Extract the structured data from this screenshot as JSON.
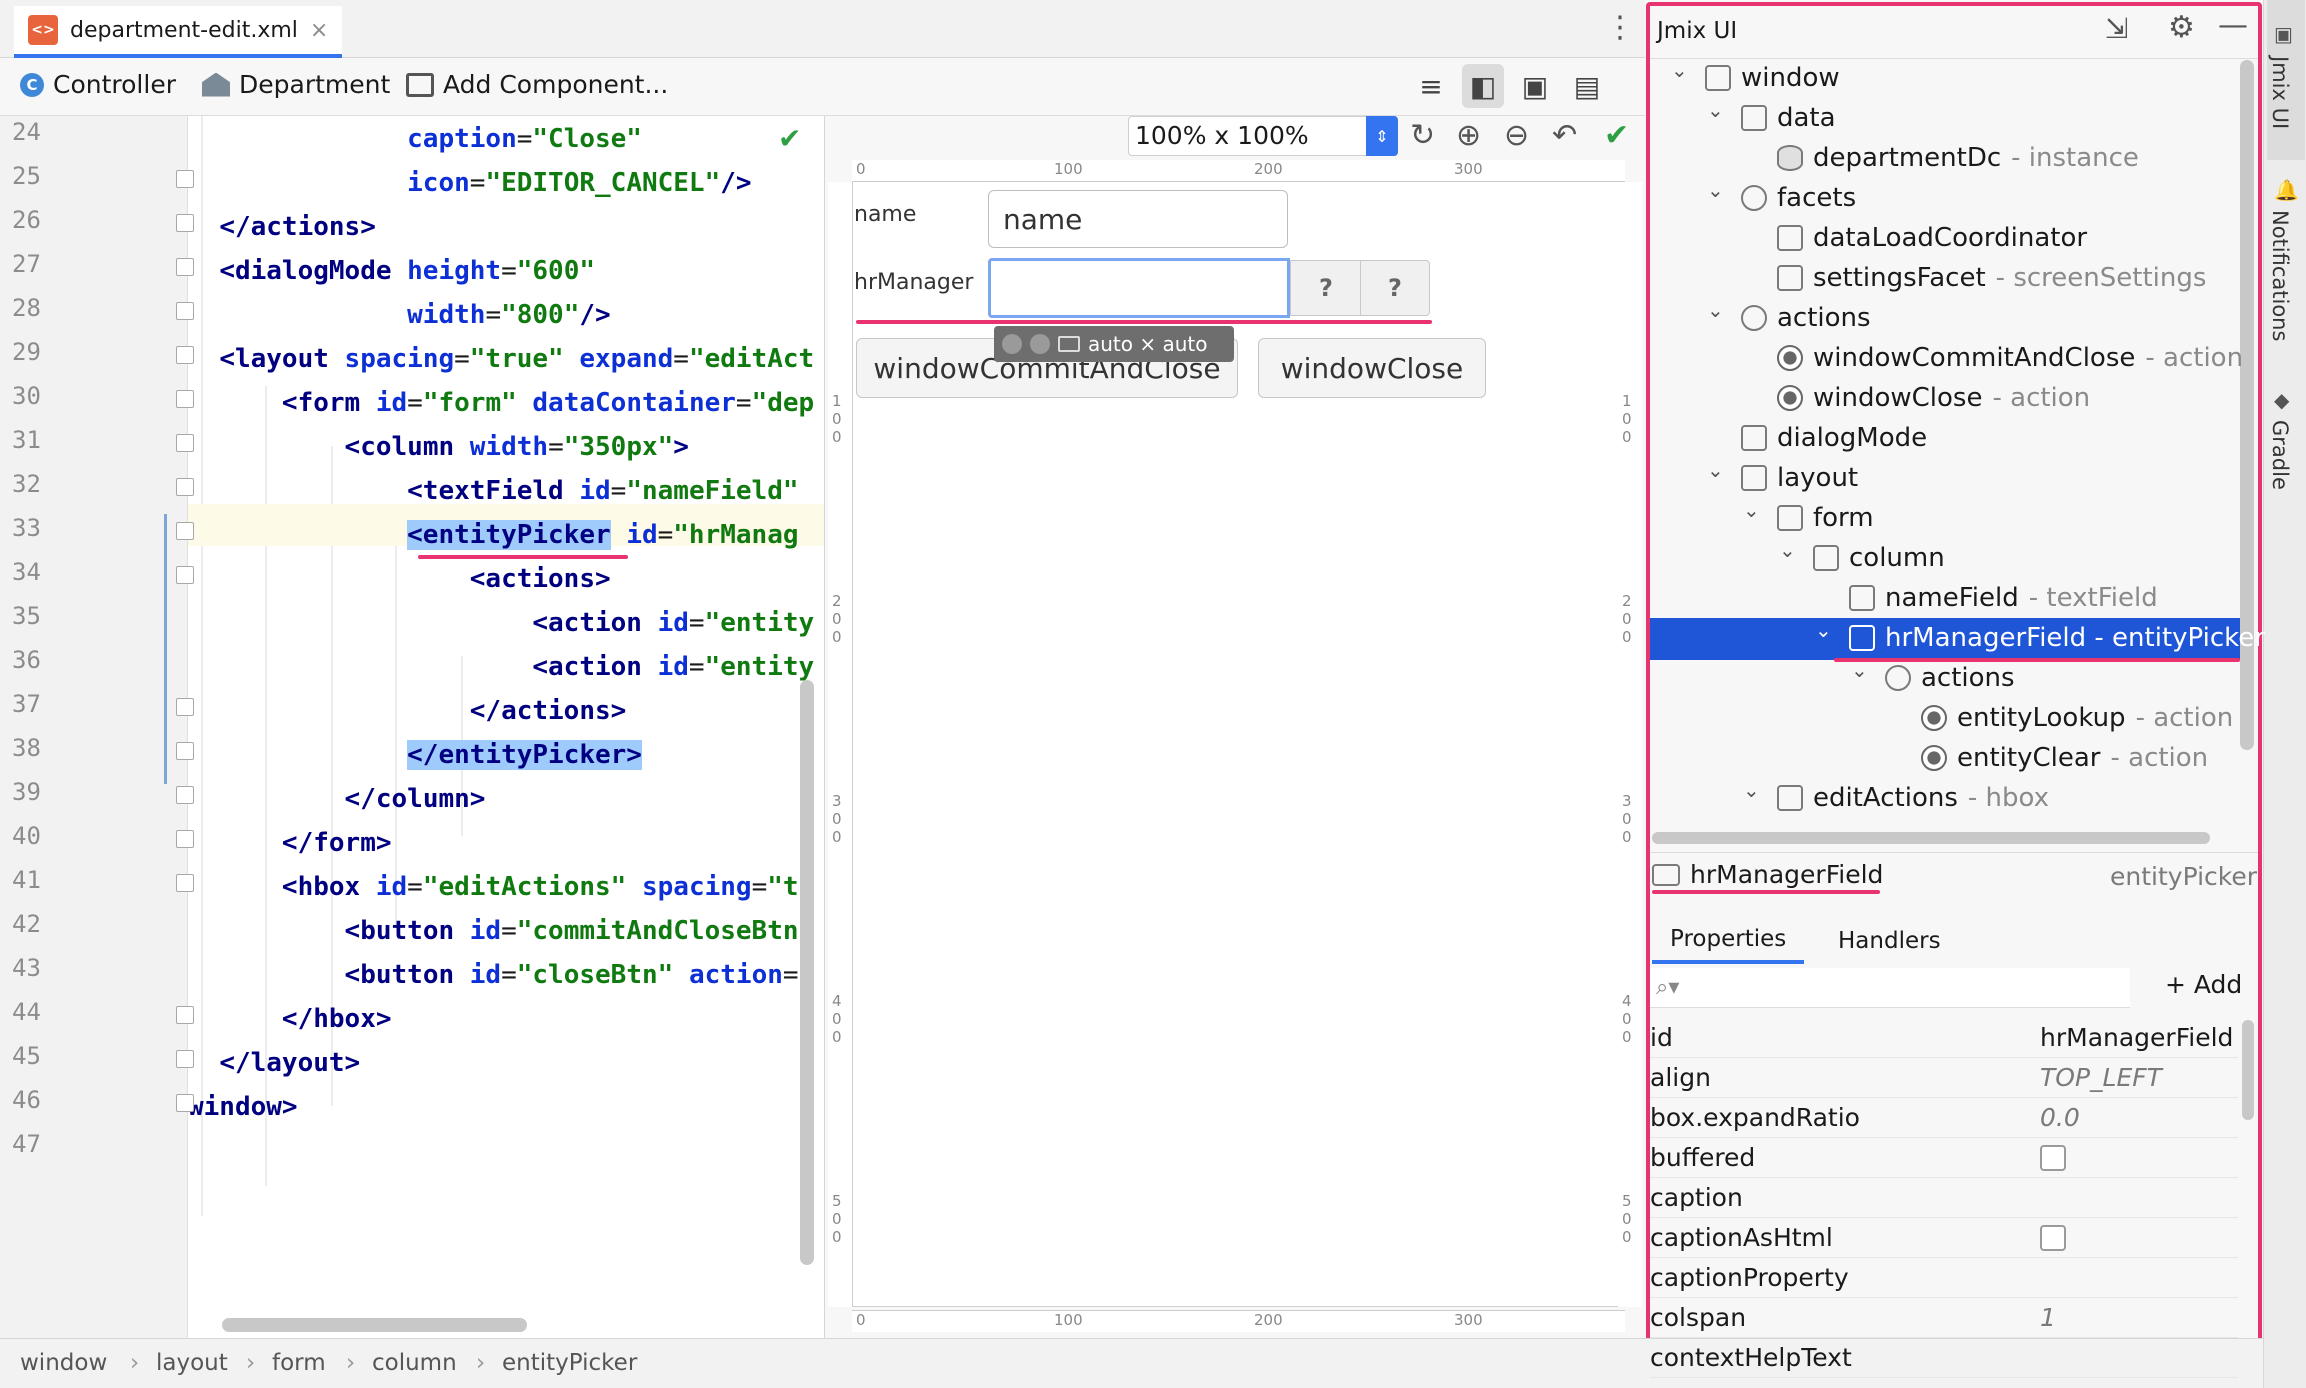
{
  "tab": {
    "filename": "department-edit.xml",
    "icon": "xml-file-icon"
  },
  "toolbar": {
    "controller": "Controller",
    "department": "Department",
    "add_component": "Add Component..."
  },
  "editor": {
    "line_numbers": [
      "24",
      "25",
      "26",
      "27",
      "28",
      "29",
      "30",
      "31",
      "32",
      "33",
      "34",
      "35",
      "36",
      "37",
      "38",
      "39",
      "40",
      "41",
      "42",
      "43",
      "44",
      "45",
      "46",
      "47"
    ]
  },
  "designer": {
    "zoom": "100% x 100%",
    "ruler_h": [
      "0",
      "100",
      "200",
      "300"
    ],
    "ruler_v": [
      "1 0 0",
      "2 0 0",
      "3 0 0",
      "4 0 0",
      "5 0 0"
    ],
    "label_name": "name",
    "label_hrmanager": "hrManager",
    "name_value": "name",
    "lookup_q": "?",
    "clear_q": "?",
    "size_badge": "auto × auto",
    "btn_commit": "windowCommitAndClose",
    "btn_close": "windowClose"
  },
  "jmix": {
    "title": "Jmix UI",
    "tree": [
      {
        "label": "window",
        "suffix": ""
      },
      {
        "label": "data",
        "suffix": ""
      },
      {
        "label": "departmentDc",
        "suffix": " - instance"
      },
      {
        "label": "facets",
        "suffix": ""
      },
      {
        "label": "dataLoadCoordinator",
        "suffix": ""
      },
      {
        "label": "settingsFacet",
        "suffix": " - screenSettings"
      },
      {
        "label": "actions",
        "suffix": ""
      },
      {
        "label": "windowCommitAndClose",
        "suffix": " - action"
      },
      {
        "label": "windowClose",
        "suffix": " - action"
      },
      {
        "label": "dialogMode",
        "suffix": ""
      },
      {
        "label": "layout",
        "suffix": ""
      },
      {
        "label": "form",
        "suffix": ""
      },
      {
        "label": "column",
        "suffix": ""
      },
      {
        "label": "nameField",
        "suffix": " - textField"
      },
      {
        "label": "hrManagerField - entityPicker",
        "suffix": ""
      },
      {
        "label": "actions",
        "suffix": ""
      },
      {
        "label": "entityLookup",
        "suffix": " - action"
      },
      {
        "label": "entityClear",
        "suffix": " - action"
      },
      {
        "label": "editActions",
        "suffix": " - hbox"
      }
    ],
    "selected_name": "hrManagerField",
    "selected_type": "entityPicker",
    "tabs": {
      "properties": "Properties",
      "handlers": "Handlers"
    },
    "add": "+ Add",
    "props": [
      {
        "name": "id",
        "value": "hrManagerField"
      },
      {
        "name": "align",
        "value": "TOP_LEFT"
      },
      {
        "name": "box.expandRatio",
        "value": "0.0"
      },
      {
        "name": "buffered",
        "value": ""
      },
      {
        "name": "caption",
        "value": ""
      },
      {
        "name": "captionAsHtml",
        "value": ""
      },
      {
        "name": "captionProperty",
        "value": ""
      },
      {
        "name": "colspan",
        "value": "1"
      },
      {
        "name": "contextHelpText",
        "value": ""
      }
    ]
  },
  "side": {
    "jmix": "Jmix UI",
    "notifications": "Notifications",
    "gradle": "Gradle"
  },
  "breadcrumbs": [
    "window",
    "layout",
    "form",
    "column",
    "entityPicker"
  ],
  "colors": {
    "accent": "#3574f0",
    "highlight": "#e8336e",
    "selection": "#1f56d8"
  }
}
